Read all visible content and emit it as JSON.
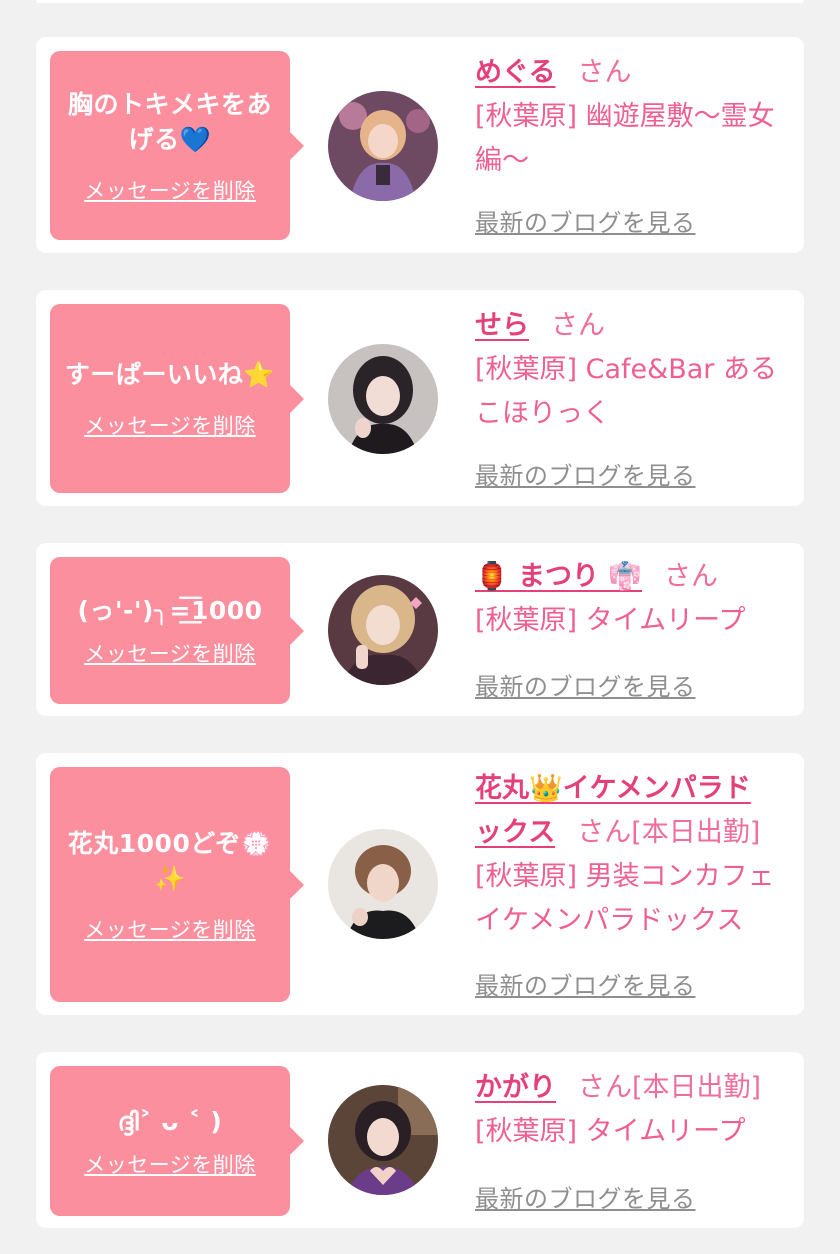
{
  "delete_label": "メッセージを削除",
  "blog_label": "最新のブログを見る",
  "honorific": "さん",
  "cards": [
    {
      "message_lines": [
        "胸のトキメキをあ",
        "げる💙"
      ],
      "name": "めぐる",
      "status": "",
      "shop_lines": [
        "[秋葉原] 幽遊屋敷〜霊女",
        "編〜"
      ]
    },
    {
      "message_lines": [
        "すーぱーいいね⭐"
      ],
      "name": "せら",
      "status": "",
      "shop_lines": [
        "[秋葉原] Cafe&Bar ある",
        "こほりっく"
      ]
    },
    {
      "message_lines": [
        "(っ'-')╮=͟͟͞͞1000"
      ],
      "name": "🏮 まつり 👘",
      "status": "",
      "shop_lines": [
        "[秋葉原] タイムリープ"
      ]
    },
    {
      "message_lines": [
        "花丸1000どぞ💮",
        "✨"
      ],
      "name_lines": [
        "花丸👑イケメンパラド",
        "ックス"
      ],
      "status": "[本日出勤]",
      "shop_lines": [
        "[秋葉原] 男装コンカフェ",
        "イケメンパラドックス"
      ]
    },
    {
      "message_lines": [
        "ദ്ദി˃ ᴗ ˂ )"
      ],
      "name": "かがり",
      "status": "[本日出勤]",
      "shop_lines": [
        "[秋葉原] タイムリープ"
      ]
    }
  ],
  "colors": {
    "background": "#f1f1f1",
    "card": "#ffffff",
    "bubble": "#fb8f9e",
    "name": "#e5407a",
    "shop": "#ef5f8f",
    "blog_link": "#8f8f8f"
  }
}
